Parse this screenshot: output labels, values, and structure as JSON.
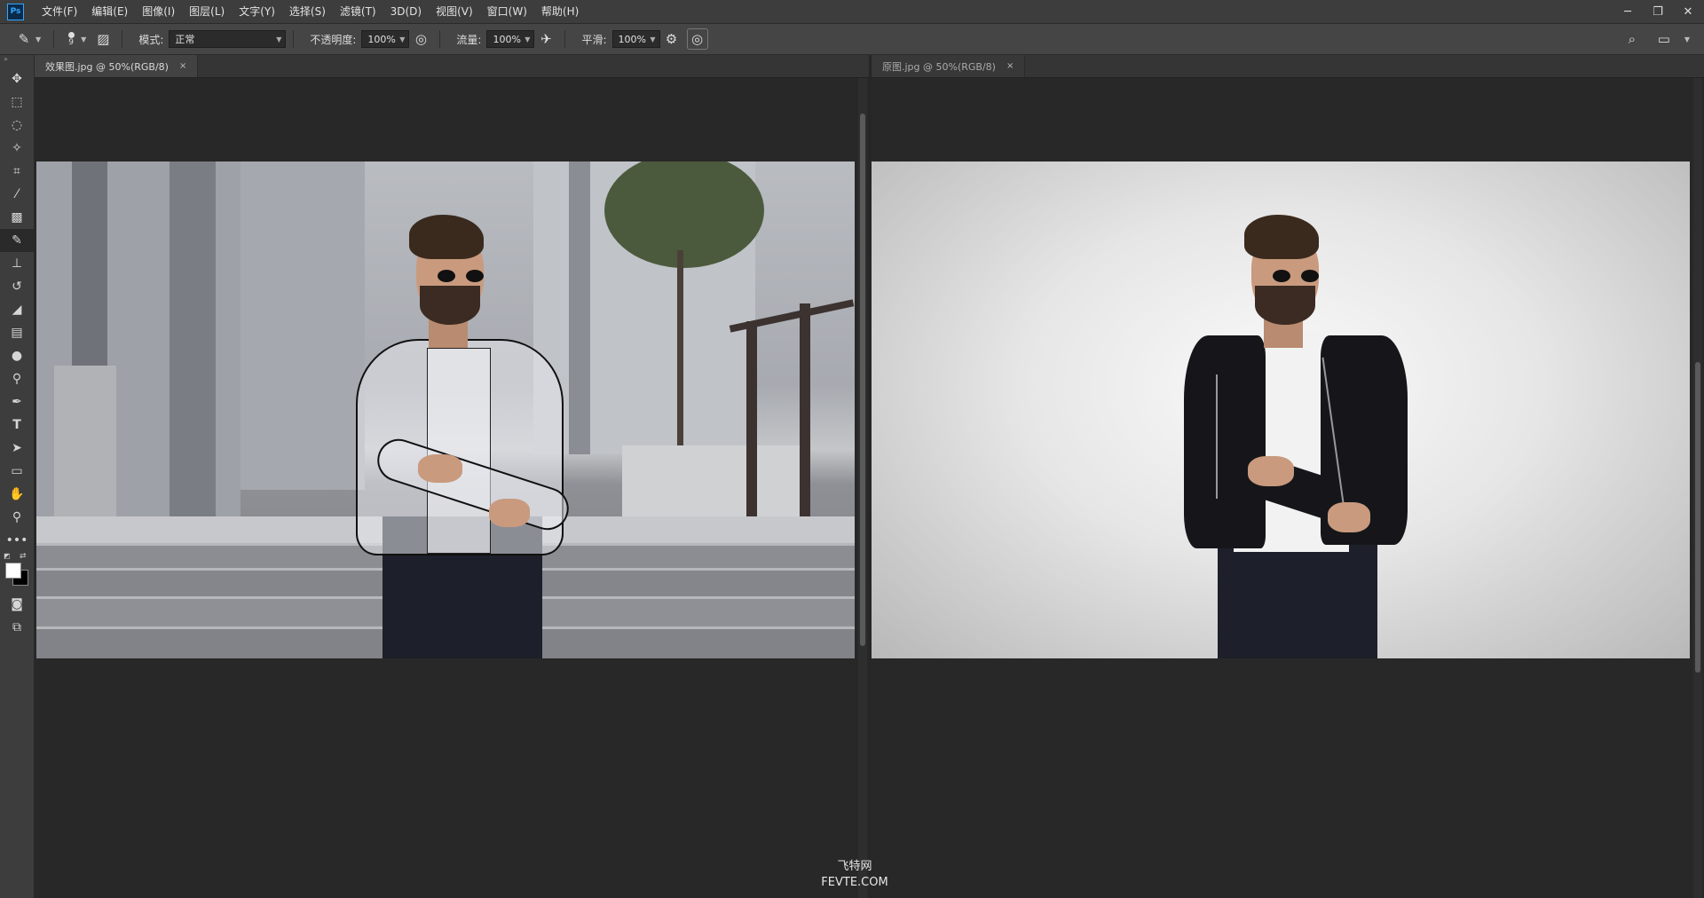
{
  "app": {
    "logo": "Ps"
  },
  "menu": [
    "文件(F)",
    "编辑(E)",
    "图像(I)",
    "图层(L)",
    "文字(Y)",
    "选择(S)",
    "滤镜(T)",
    "3D(D)",
    "视图(V)",
    "窗口(W)",
    "帮助(H)"
  ],
  "window_controls": {
    "minimize": "─",
    "restore": "❐",
    "close": "✕"
  },
  "options": {
    "brush_size": "9",
    "mode_label": "模式:",
    "mode_value": "正常",
    "opacity_label": "不透明度:",
    "opacity_value": "100%",
    "flow_label": "流量:",
    "flow_value": "100%",
    "smoothing_label": "平滑:",
    "smoothing_value": "100%"
  },
  "tools": [
    "move-tool",
    "marquee-tool",
    "lasso-tool",
    "quick-select-tool",
    "crop-tool",
    "eyedropper-tool",
    "healing-tool",
    "brush-tool",
    "stamp-tool",
    "history-brush-tool",
    "eraser-tool",
    "gradient-tool",
    "blur-tool",
    "dodge-tool",
    "pen-tool",
    "type-tool",
    "path-select-tool",
    "shape-tool",
    "hand-tool",
    "zoom-tool",
    "more-tools"
  ],
  "documents": {
    "left": {
      "tab": "效果图.jpg @ 50%(RGB/8)",
      "close": "×"
    },
    "right": {
      "tab": "原图.jpg @ 50%(RGB/8)",
      "close": "×"
    }
  },
  "watermark": {
    "line1": "飞特网",
    "line2": "FEVTE.COM"
  }
}
